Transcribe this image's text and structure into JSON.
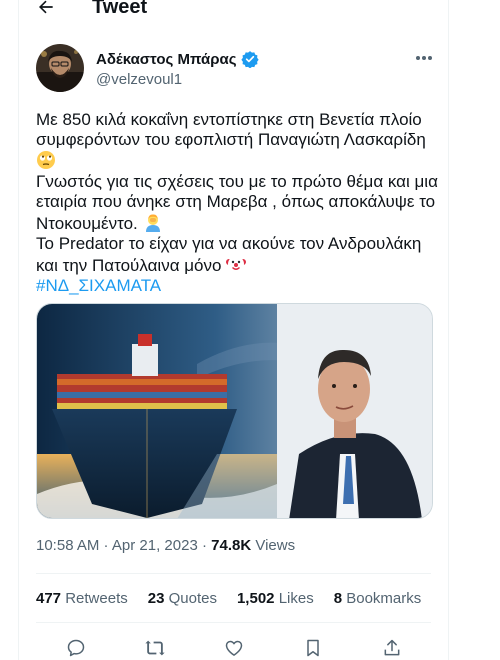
{
  "header": {
    "title": "Tweet",
    "back_icon": "arrow-left-icon"
  },
  "author": {
    "display_name": "Αδέκαστος Μπάρας",
    "handle": "@velzevoul1",
    "verified_color": "#1d9bf0"
  },
  "tweet": {
    "lines": [
      "Με 850 κιλά κοκαΐνη εντοπίστηκε στη Βενετία πλοίο",
      "συμφερόντων του εφοπλιστή Παναγιώτη Λασκαρίδη",
      "Γνωστός για τις σχέσεις του με το πρώτο θέμα και μια",
      "εταιρία που άνηκε στη Μαρεβα , όπως αποκάλυψε το",
      "Ντοκουμέντο.",
      "Το Predator το είχαν για να ακούνε τον Ανδρουλάκη",
      "και την Πατούλαινα μόνο"
    ],
    "hashtag": "#ΝΔ_ΣΙΧΑΜΑΤΑ",
    "hashtag_color": "#1d9bf0",
    "emojis": [
      "face-with-rolling-eyes",
      "person-facepalming",
      "clown-face"
    ]
  },
  "meta": {
    "time": "10:58 AM",
    "separator": " · ",
    "date": "Apr 21, 2023",
    "views_count": "74.8K",
    "views_label": "Views"
  },
  "stats": {
    "retweets_count": "477",
    "retweets_label": "Retweets",
    "quotes_count": "23",
    "quotes_label": "Quotes",
    "likes_count": "1,502",
    "likes_label": "Likes",
    "bookmarks_count": "8",
    "bookmarks_label": "Bookmarks"
  },
  "actions": [
    "reply-icon",
    "retweet-icon",
    "like-icon",
    "bookmark-icon",
    "share-icon"
  ],
  "colors": {
    "text": "#0f1419",
    "secondary": "#536471",
    "border": "#eff3f4",
    "accent": "#1d9bf0"
  }
}
